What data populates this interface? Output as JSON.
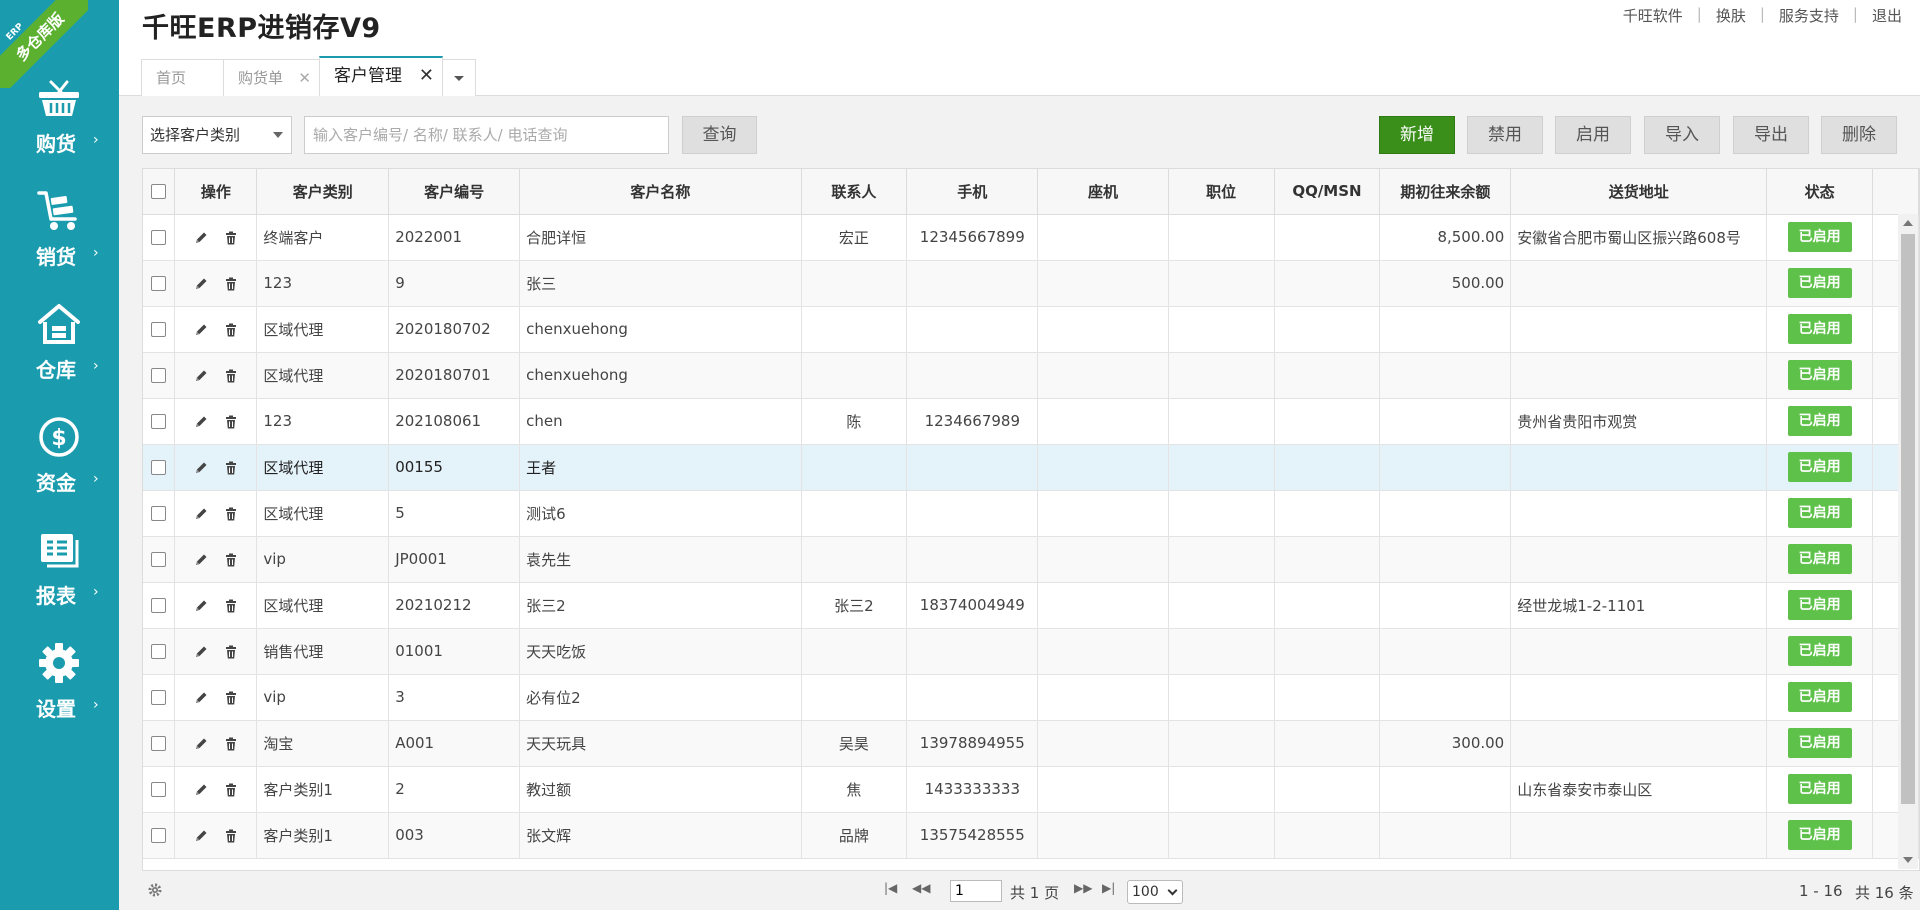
{
  "app": {
    "title": "千旺ERP进销存V9",
    "badge_top": "ERP",
    "badge_main": "多仓库版"
  },
  "top_links": [
    "千旺软件",
    "换肤",
    "服务支持",
    "退出"
  ],
  "sidebar": {
    "items": [
      {
        "label": "购货",
        "icon": "basket-icon"
      },
      {
        "label": "销货",
        "icon": "cart-icon"
      },
      {
        "label": "仓库",
        "icon": "warehouse-icon"
      },
      {
        "label": "资金",
        "icon": "dollar-icon"
      },
      {
        "label": "报表",
        "icon": "report-icon"
      },
      {
        "label": "设置",
        "icon": "gear-icon"
      }
    ]
  },
  "tabs": [
    {
      "label": "首页"
    },
    {
      "label": "购货单"
    },
    {
      "label": "客户管理",
      "active": true
    }
  ],
  "toolbar": {
    "category_select": "选择客户类别",
    "search_placeholder": "输入客户编号/ 名称/ 联系人/ 电话查询",
    "query_label": "查询",
    "buttons": [
      "新增",
      "禁用",
      "启用",
      "导入",
      "导出",
      "删除"
    ]
  },
  "table": {
    "headers": [
      "操作",
      "客户类别",
      "客户编号",
      "客户名称",
      "联系人",
      "手机",
      "座机",
      "职位",
      "QQ/MSN",
      "期初往来余额",
      "送货地址",
      "状态"
    ],
    "status_label": "已启用",
    "rows": [
      {
        "category": "终端客户",
        "code": "2022001",
        "name": "合肥详恒",
        "contact": "宏正",
        "mobile": "12345667899",
        "phone": "",
        "position": "",
        "qq": "",
        "balance": "8,500.00",
        "address": "安徽省合肥市蜀山区振兴路608号"
      },
      {
        "category": "123",
        "code": "9",
        "name": "张三",
        "contact": "",
        "mobile": "",
        "phone": "",
        "position": "",
        "qq": "",
        "balance": "500.00",
        "address": ""
      },
      {
        "category": "区域代理",
        "code": "2020180702",
        "name": "chenxuehong",
        "contact": "",
        "mobile": "",
        "phone": "",
        "position": "",
        "qq": "",
        "balance": "",
        "address": ""
      },
      {
        "category": "区域代理",
        "code": "2020180701",
        "name": "chenxuehong",
        "contact": "",
        "mobile": "",
        "phone": "",
        "position": "",
        "qq": "",
        "balance": "",
        "address": ""
      },
      {
        "category": "123",
        "code": "202108061",
        "name": "chen",
        "contact": "陈",
        "mobile": "1234667989",
        "phone": "",
        "position": "",
        "qq": "",
        "balance": "",
        "address": "贵州省贵阳市观赏"
      },
      {
        "category": "区域代理",
        "code": "00155",
        "name": "王者",
        "contact": "",
        "mobile": "",
        "phone": "",
        "position": "",
        "qq": "",
        "balance": "",
        "address": ""
      },
      {
        "category": "区域代理",
        "code": "5",
        "name": "测试6",
        "contact": "",
        "mobile": "",
        "phone": "",
        "position": "",
        "qq": "",
        "balance": "",
        "address": ""
      },
      {
        "category": "vip",
        "code": "JP0001",
        "name": "袁先生",
        "contact": "",
        "mobile": "",
        "phone": "",
        "position": "",
        "qq": "",
        "balance": "",
        "address": ""
      },
      {
        "category": "区域代理",
        "code": "20210212",
        "name": "张三2",
        "contact": "张三2",
        "mobile": "18374004949",
        "phone": "",
        "position": "",
        "qq": "",
        "balance": "",
        "address": "经世龙城1-2-1101"
      },
      {
        "category": "销售代理",
        "code": "01001",
        "name": "天天吃饭",
        "contact": "",
        "mobile": "",
        "phone": "",
        "position": "",
        "qq": "",
        "balance": "",
        "address": ""
      },
      {
        "category": "vip",
        "code": "3",
        "name": "必有位2",
        "contact": "",
        "mobile": "",
        "phone": "",
        "position": "",
        "qq": "",
        "balance": "",
        "address": ""
      },
      {
        "category": "淘宝",
        "code": "A001",
        "name": "天天玩具",
        "contact": "吴昊",
        "mobile": "13978894955",
        "phone": "",
        "position": "",
        "qq": "",
        "balance": "300.00",
        "address": ""
      },
      {
        "category": "客户类别1",
        "code": "2",
        "name": "教过额",
        "contact": "焦",
        "mobile": "1433333333",
        "phone": "",
        "position": "",
        "qq": "",
        "balance": "",
        "address": "山东省泰安市泰山区"
      },
      {
        "category": "客户类别1",
        "code": "003",
        "name": "张文辉",
        "contact": "品牌",
        "mobile": "13575428555",
        "phone": "",
        "position": "",
        "qq": "",
        "balance": "",
        "address": ""
      }
    ]
  },
  "pager": {
    "page": "1",
    "total_pages_text": "共 1 页",
    "page_size": "100",
    "range_text": "1 - 16",
    "total_text": "共 16 条"
  }
}
